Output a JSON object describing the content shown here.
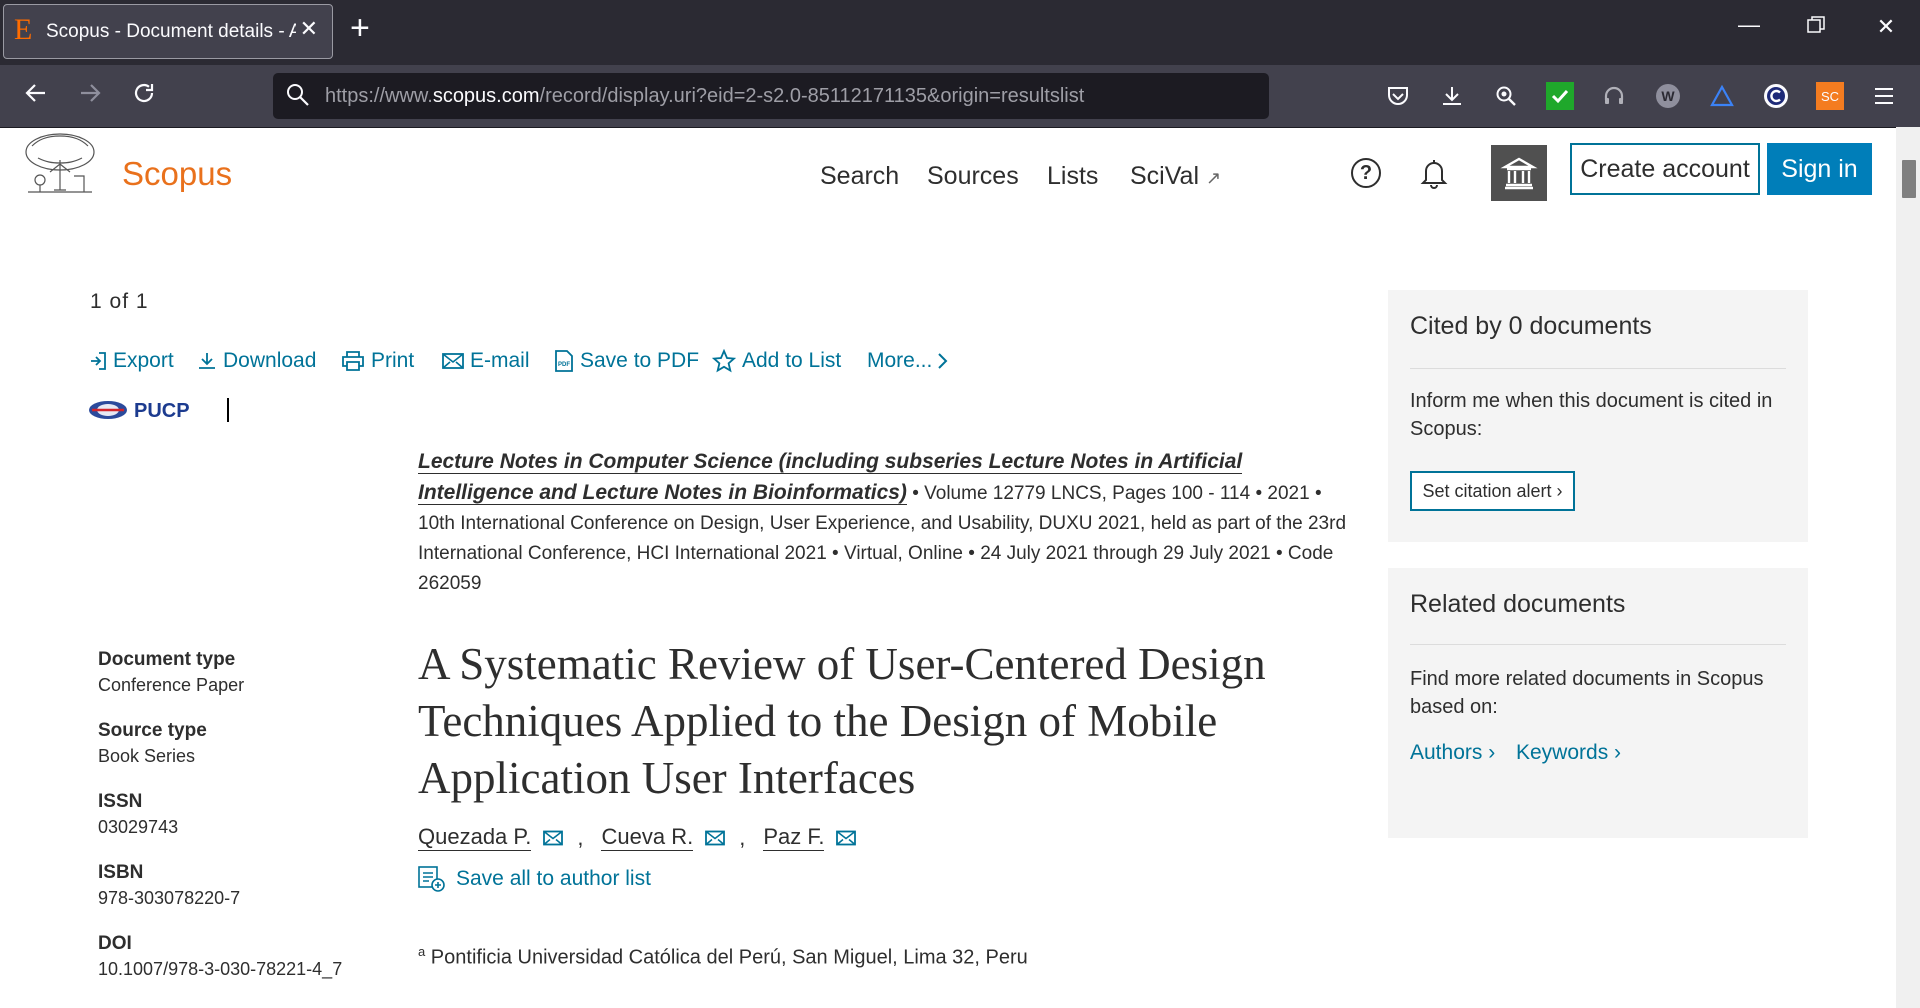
{
  "browser": {
    "tab_title": "Scopus - Document details - A Systematic Review",
    "tab_favicon": "E",
    "new_tab": "+",
    "url_prefix": "https://www.",
    "url_domain": "scopus.com",
    "url_path": "/record/display.uri?eid=2-s2.0-85112171135&origin=resultslist",
    "extensions": [
      {
        "name": "pocket-icon"
      },
      {
        "name": "download-icon"
      },
      {
        "name": "zoom-icon"
      },
      {
        "name": "check-extension-icon",
        "color": "#1fa82b"
      },
      {
        "name": "headset-extension-icon"
      },
      {
        "name": "w-extension-icon"
      },
      {
        "name": "triangle-extension-icon"
      },
      {
        "name": "c-extension-icon"
      },
      {
        "name": "sc-extension-icon",
        "label": "SC",
        "color": "#f47c20"
      },
      {
        "name": "menu-icon"
      }
    ]
  },
  "header": {
    "brand": "Scopus",
    "nav": [
      "Search",
      "Sources",
      "Lists",
      "SciVal"
    ],
    "sival_external": "↗",
    "help": "?",
    "create_account": "Create account",
    "sign_in": "Sign in"
  },
  "toolbar": {
    "counter": "1 of 1",
    "actions": [
      "Export",
      "Download",
      "Print",
      "E-mail",
      "Save to PDF",
      "Add to List",
      "More..."
    ]
  },
  "institution_logo": "PUCP",
  "source": {
    "journal": "Lecture Notes in Computer Science (including subseries Lecture Notes in Artificial Intelligence and Lecture Notes in Bioinformatics)",
    "volume": "Volume 12779 LNCS, Pages 100 - 114",
    "year": "2021",
    "conference": "10th International Conference on Design, User Experience, and Usability, DUXU 2021, held as part of the 23rd International Conference, HCI International 2021",
    "location": "Virtual, Online",
    "dates": "24 July 2021 through 29 July 2021",
    "code": "Code 262059"
  },
  "metadata": [
    {
      "label": "Document type",
      "value": "Conference Paper"
    },
    {
      "label": "Source type",
      "value": "Book Series"
    },
    {
      "label": "ISSN",
      "value": "03029743"
    },
    {
      "label": "ISBN",
      "value": "978-303078220-7"
    },
    {
      "label": "DOI",
      "value": "10.1007/978-3-030-78221-4_7"
    }
  ],
  "document": {
    "title": "A Systematic Review of User-Centered Design Techniques Applied to the Design of Mobile Application User Interfaces",
    "authors": [
      "Quezada P.",
      "Cueva R.",
      "Paz F."
    ],
    "author_separator": ",",
    "save_all": "Save all to author list",
    "affiliation_marker": "a",
    "affiliation": "Pontificia Universidad Católica del Perú, San Miguel, Lima 32, Peru"
  },
  "cited_panel": {
    "heading": "Cited by 0 documents",
    "text": "Inform me when this document is cited in Scopus:",
    "alert_button": "Set citation alert"
  },
  "related_panel": {
    "heading": "Related documents",
    "text": "Find more related documents in Scopus based on:",
    "links": [
      "Authors",
      "Keywords"
    ]
  },
  "colors": {
    "brand": "#e9711c",
    "link": "#007398",
    "sign_in": "#007eb9"
  }
}
